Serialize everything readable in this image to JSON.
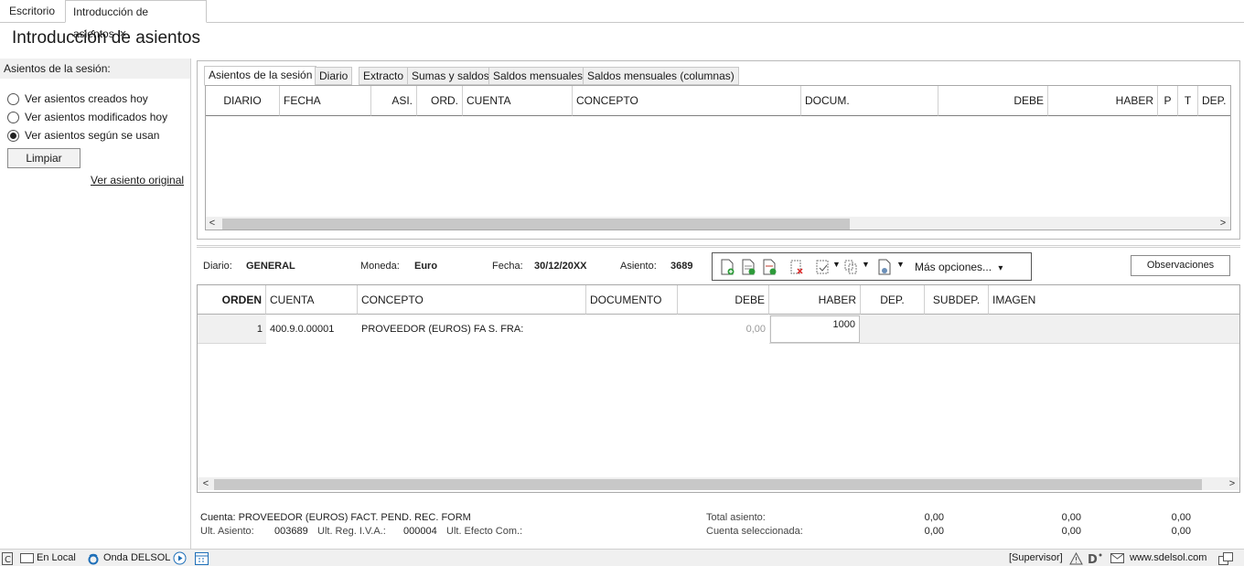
{
  "doc_tabs": [
    {
      "label": "Escritorio"
    },
    {
      "label": "Introducción de asientos",
      "close": "×"
    }
  ],
  "page_title": "Introducción de asientos",
  "left_panel": {
    "header": "Asientos de la sesión:",
    "options": [
      {
        "label": "Ver asientos creados hoy",
        "selected": false
      },
      {
        "label": "Ver asientos modificados hoy",
        "selected": false
      },
      {
        "label": "Ver asientos según se usan",
        "selected": true
      }
    ],
    "clear_button": "Limpiar",
    "original_link": "Ver asiento original"
  },
  "session_tabs": [
    "Asientos de la sesión",
    "Diario",
    "Extracto",
    "Sumas y saldos",
    "Saldos mensuales",
    "Saldos mensuales (columnas)"
  ],
  "session_grid": {
    "columns": [
      "DIARIO",
      "FECHA",
      "ASI.",
      "ORD.",
      "CUENTA",
      "CONCEPTO",
      "DOCUM.",
      "DEBE",
      "HABER",
      "P",
      "T",
      "DEP."
    ]
  },
  "entry_info": {
    "diario_label": "Diario:",
    "diario_value": "GENERAL",
    "moneda_label": "Moneda:",
    "moneda_value": "Euro",
    "fecha_label": "Fecha:",
    "fecha_value": "30/12/20XX",
    "asiento_label": "Asiento:",
    "asiento_value": "3689"
  },
  "toolbar": {
    "icons": [
      "new-entry-icon",
      "add-line-icon",
      "insert-line-icon",
      "delete-line-icon",
      "check-options-icon",
      "copy-options-icon",
      "document-options-icon"
    ],
    "more_options": "Más opciones...",
    "more_arrow": "▾"
  },
  "observations_button": "Observaciones",
  "entry_grid": {
    "columns": [
      "ORDEN",
      "CUENTA",
      "CONCEPTO",
      "DOCUMENTO",
      "DEBE",
      "HABER",
      "DEP.",
      "SUBDEP.",
      "IMAGEN"
    ],
    "rows": [
      {
        "orden": "1",
        "cuenta": "400.9.0.00001",
        "concepto": "PROVEEDOR (EUROS) FA S. FRA:",
        "documento": "",
        "debe": "0,00",
        "haber": "1000",
        "dep": "",
        "subdep": "",
        "imagen": ""
      }
    ]
  },
  "footer": {
    "cuenta_line": "Cuenta: PROVEEDOR (EUROS) FACT. PEND. REC. FORM",
    "ult_asiento_label": "Ult. Asiento:",
    "ult_asiento_value": "003689",
    "ult_iva_label": "Ult. Reg. I.V.A.:",
    "ult_iva_value": "000004",
    "ult_efecto_label": "Ult. Efecto Com.:",
    "total_label": "Total asiento:",
    "selected_label": "Cuenta seleccionada:",
    "total_values": [
      "0,00",
      "0,00",
      "0,00"
    ],
    "selected_values": [
      "0,00",
      "0,00",
      "0,00"
    ]
  },
  "statusbar": {
    "local": "En Local",
    "onda": "Onda DELSOL",
    "user": "[Supervisor]",
    "web": "www.sdelsol.com"
  }
}
